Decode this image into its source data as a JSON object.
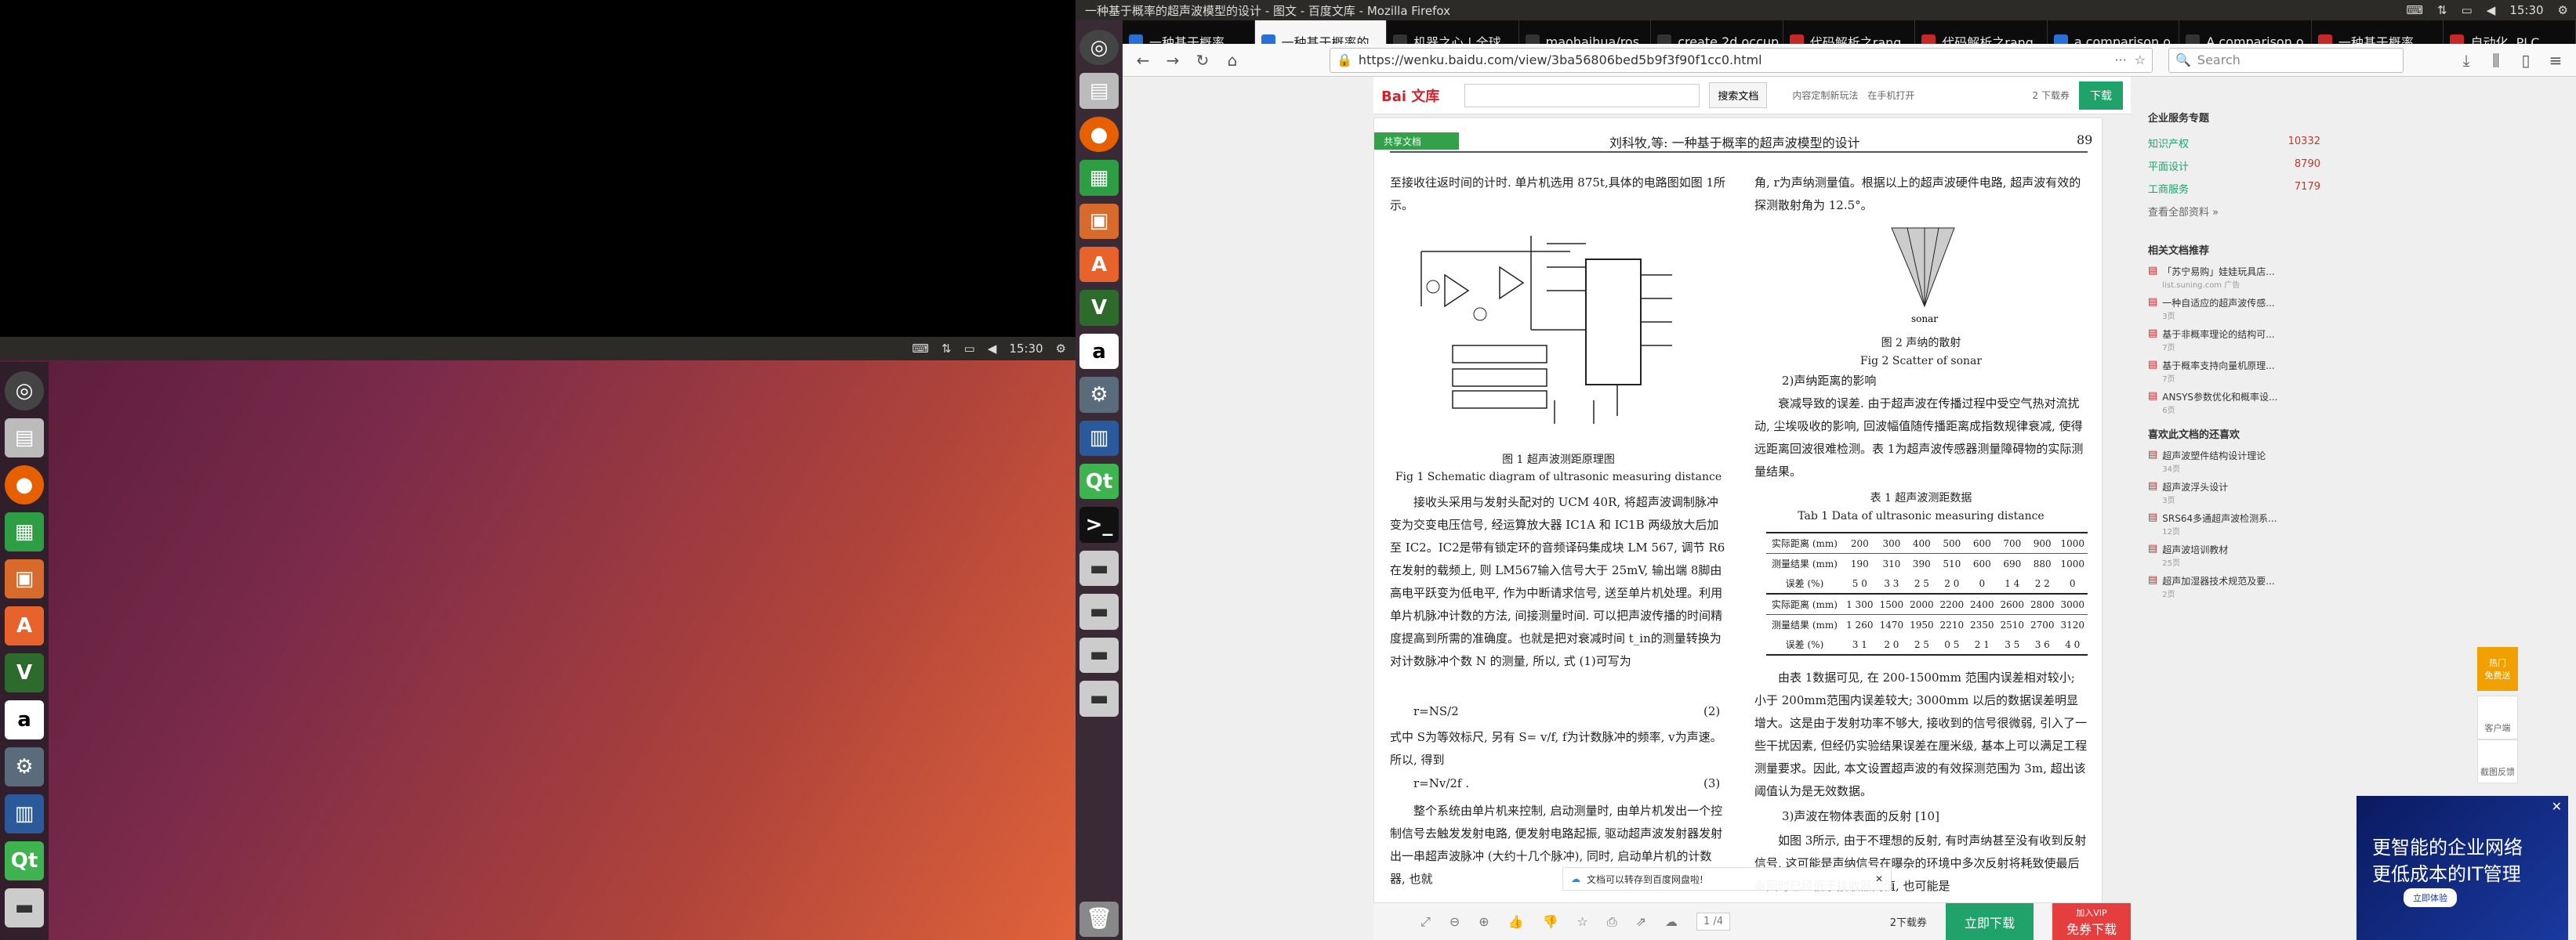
{
  "window": {
    "title": "一种基于概率的超声波模型的设计 - 图文 - 百度文库 - Mozilla Firefox",
    "clock": "15:30"
  },
  "desktop_panel": {
    "clock": "15:30"
  },
  "tabs": [
    {
      "label": "一种基于概率",
      "active": false
    },
    {
      "label": "一种基于概率的",
      "active": true
    },
    {
      "label": "机器之心 | 全球",
      "active": false
    },
    {
      "label": "maohaihua/ros",
      "active": false
    },
    {
      "label": "create 2d occup",
      "active": false
    },
    {
      "label": "代码解析之rang",
      "active": false
    },
    {
      "label": "代码解析之rang",
      "active": false
    },
    {
      "label": "a comparison o",
      "active": false
    },
    {
      "label": "A comparison o",
      "active": false
    },
    {
      "label": "一种基于概率",
      "active": false
    },
    {
      "label": "自动化, PLC,",
      "active": false
    }
  ],
  "nav": {
    "url": "https://wenku.baidu.com/view/3ba56806bed5b9f3f90f1cc0.html",
    "search_placeholder": "Search"
  },
  "wenku": {
    "logo": "Bai 文库",
    "search_btn": "搜索文档",
    "links": [
      "内容定制新玩法",
      "在手机打开"
    ],
    "pages": "2 下载券",
    "download": "下载"
  },
  "doc_header": {
    "badge": "共享文档",
    "title": "刘科牧,等: 一种基于概率的超声波模型的设计",
    "page": "89"
  },
  "left_col": {
    "intro": "至接收往返时间的计时. 单片机选用 875t,具体的电路图如图 1所示。",
    "fig1_cap_cn": "图 1  超声波测距原理图",
    "fig1_cap_en": "Fig 1   Schematic diagram of ultrasonic measuring distance",
    "para1": "接收头采用与发射头配对的 UCM 40R, 将超声波调制脉冲变为交变电压信号, 经运算放大器 IC1A 和 IC1B 两级放大后加至 IC2。IC2是带有锁定环的音频译码集成块 LM 567, 调节 R6 在发射的载频上, 则 LM567输入信号大于 25mV, 输出端 8脚由高电平跃变为低电平, 作为中断请求信号, 送至单片机处理。利用单片机脉冲计数的方法, 间接测量时间. 可以把声波传播的时间精度提高到所需的准确度。也就是把对衰减时间 t_in的测量转换为对计数脉冲个数 N 的测量, 所以, 式 (1)可写为",
    "eq2": "r=NS/2",
    "eq2n": "(2)",
    "para2": "式中 S为等效标尺, 另有 S= v/f, f为计数脉冲的频率, v为声速。所以, 得到",
    "eq3": "r=Nv/2f .",
    "eq3n": "(3)",
    "para3": "整个系统由单片机来控制, 启动测量时, 由单片机发出一个控制信号去触发发射电路, 便发射电路起振, 驱动超声波发射器发射出一串超声波脉冲 (大约十几个脉冲), 同时, 启动单片机的计数器, 也就"
  },
  "right_col": {
    "intro": "角, r为声纳测量值。根据以上的超声波硬件电路, 超声波有效的探测散射角为 12.5°。",
    "fig2_cap_cn": "图 2  声纳的散射",
    "fig2_cap_en": "Fig 2   Scatter of sonar",
    "fig2_label": "sonar",
    "sec2": "2)声纳距离的影响",
    "para1": "衰减导致的误差. 由于超声波在传播过程中受空气热对流扰动, 尘埃吸收的影响, 回波幅值随传播距离成指数规律衰减, 使得远距离回波很难检测。表 1为超声波传感器测量障碍物的实际测量结果。",
    "table_cap_cn": "表 1  超声波测距数据",
    "table_cap_en": "Tab 1   Data of ultrasonic measuring distance",
    "para2": "由表 1数据可见, 在 200-1500mm 范围内误差相对较小; 小于 200mm范围内误差较大; 3000mm 以后的数据误差明显增大。这是由于发射功率不够大, 接收到的信号很微弱, 引入了一些干扰因素, 但经仍实验结果误差在厘米级, 基本上可以满足工程测量要求。因此, 本文设置超声波的有效探测范围为 3m, 超出该阈值认为是无效数据。",
    "sec3": "3)声波在物体表面的反射 [10]",
    "para3": "如图 3所示, 由于不理想的反射, 有时声纳甚至没有收到反射信号, 这可能是声纳信号在曝杂的环境中多次反射将耗致使最后返回时已经低于接收器阈值, 也可能是"
  },
  "table": {
    "rows1": [
      [
        "实际距离 (mm)",
        "200",
        "300",
        "400",
        "500",
        "600",
        "700",
        "900",
        "1000"
      ],
      [
        "测量结果 (mm)",
        "190",
        "310",
        "390",
        "510",
        "600",
        "690",
        "880",
        "1000"
      ],
      [
        "误差 (%)",
        "5 0",
        "3 3",
        "2 5",
        "2 0",
        "0",
        "1 4",
        "2 2",
        "0"
      ]
    ],
    "rows2": [
      [
        "实际距离 (mm)",
        "1 300",
        "1500",
        "2000",
        "2200",
        "2400",
        "2600",
        "2800",
        "3000"
      ],
      [
        "测量结果 (mm)",
        "1 260",
        "1470",
        "1950",
        "2210",
        "2350",
        "2510",
        "2700",
        "3120"
      ],
      [
        "误差 (%)",
        "3 1",
        "2 0",
        "2 5",
        "0 5",
        "2 1",
        "3 5",
        "3 6",
        "4 0"
      ]
    ]
  },
  "sidebar": {
    "enterprise_title": "企业服务专题",
    "enterprise_items": [
      {
        "label": "知识产权",
        "count": "10332"
      },
      {
        "label": "平面设计",
        "count": "8790"
      },
      {
        "label": "工商服务",
        "count": "7179"
      }
    ],
    "view_all": "查看全部资料 »",
    "related_title": "相关文档推荐",
    "related": [
      {
        "title": "「苏宁易购」娃娃玩具店...",
        "sub": "list.suning.com  广告"
      },
      {
        "title": "一种自适应的超声波传感...",
        "sub": "3页"
      },
      {
        "title": "基于非概率理论的结构可...",
        "sub": "7页"
      },
      {
        "title": "基于概率支持向量机原理...",
        "sub": "7页"
      },
      {
        "title": "ANSYS参数优化和概率设...",
        "sub": "6页"
      }
    ],
    "liked_title": "喜欢此文档的还喜欢",
    "liked": [
      {
        "title": "超声波塑件结构设计理论",
        "sub": "34页"
      },
      {
        "title": "超声波浮头设计",
        "sub": "3页"
      },
      {
        "title": "SRS64多通超声波检测系...",
        "sub": "12页"
      },
      {
        "title": "超声波培训教材",
        "sub": "25页"
      },
      {
        "title": "超声加湿器技术规范及要...",
        "sub": "2页"
      }
    ]
  },
  "float_tabs": [
    "热门\n免费送",
    "客户端",
    "截图反馈"
  ],
  "ad": {
    "line1": "更智能的企业网络",
    "line2": "更低成本的IT管理",
    "btn": "立即体验"
  },
  "bottom": {
    "page": "1 /4",
    "cost": "2下载券",
    "download_now": "立即下载",
    "vip": "加入VIP",
    "vip_free": "免券下载",
    "toast": "文档可以转存到百度网盘啦!"
  }
}
